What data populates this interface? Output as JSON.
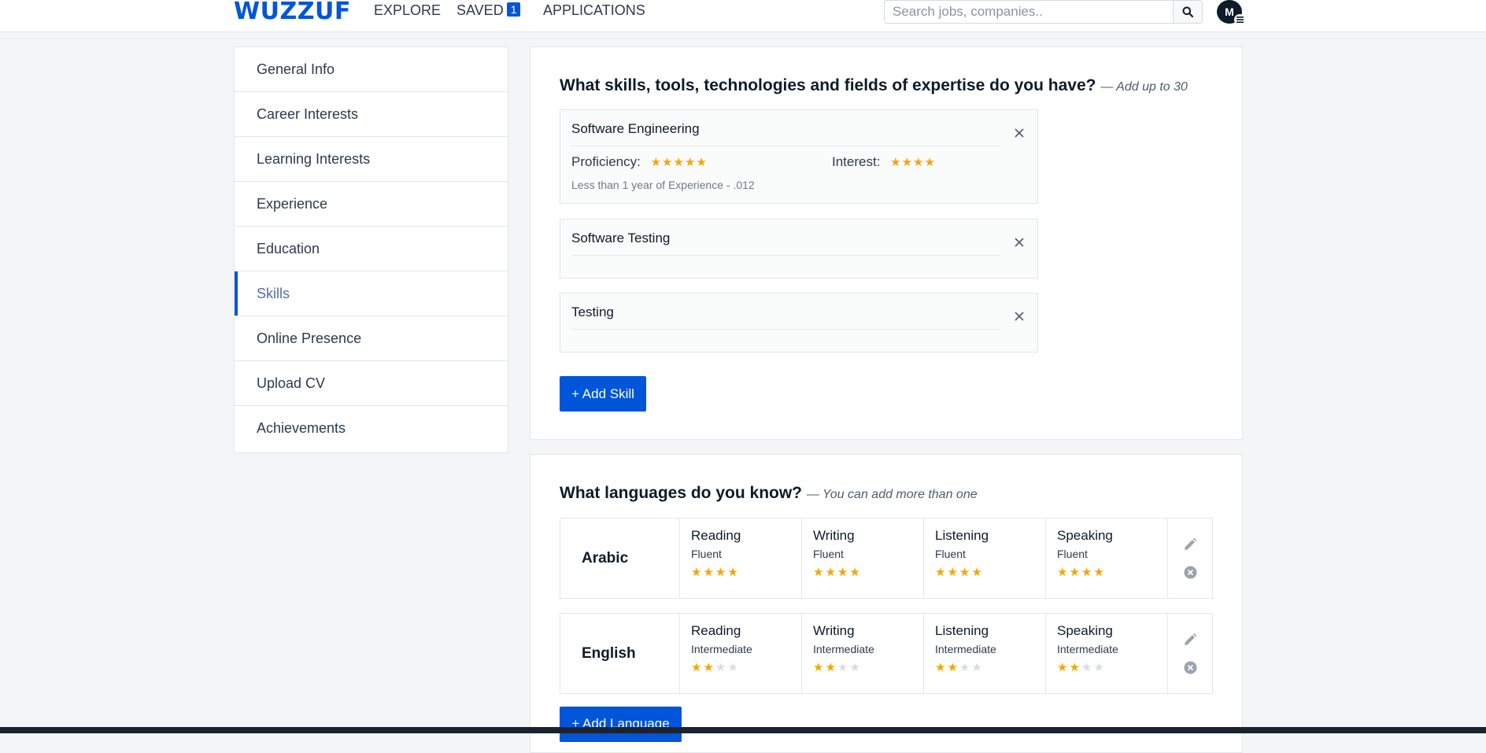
{
  "header": {
    "logo": "WUZZUF",
    "nav": {
      "explore": "EXPLORE",
      "saved": "SAVED",
      "saved_count": "1",
      "applications": "APPLICATIONS"
    },
    "search_placeholder": "Search jobs, companies..",
    "avatar_initial": "M"
  },
  "sidebar": {
    "items": [
      {
        "label": "General Info"
      },
      {
        "label": "Career Interests"
      },
      {
        "label": "Learning Interests"
      },
      {
        "label": "Experience"
      },
      {
        "label": "Education"
      },
      {
        "label": "Skills",
        "active": true
      },
      {
        "label": "Online Presence"
      },
      {
        "label": "Upload CV"
      },
      {
        "label": "Achievements"
      }
    ]
  },
  "skills_section": {
    "title": "What skills, tools, technologies and fields of expertise do you have?",
    "hint": "— Add up to 30",
    "proficiency_label": "Proficiency:",
    "interest_label": "Interest:",
    "skills": [
      {
        "name": "Software Engineering",
        "proficiency": 5,
        "interest": 4,
        "meta": "Less than 1 year of Experience - .012"
      },
      {
        "name": "Software Testing"
      },
      {
        "name": "Testing"
      }
    ],
    "add_button": "+ Add Skill"
  },
  "languages_section": {
    "title": "What languages do you know?",
    "hint": "— You can add more than one",
    "skill_labels": [
      "Reading",
      "Writing",
      "Listening",
      "Speaking"
    ],
    "languages": [
      {
        "name": "Arabic",
        "levels": [
          "Fluent",
          "Fluent",
          "Fluent",
          "Fluent"
        ],
        "stars": [
          4,
          4,
          4,
          4
        ],
        "max": 4
      },
      {
        "name": "English",
        "levels": [
          "Intermediate",
          "Intermediate",
          "Intermediate",
          "Intermediate"
        ],
        "stars": [
          2,
          2,
          2,
          2
        ],
        "max": 4
      }
    ],
    "add_button": "+ Add Language"
  },
  "colors": {
    "brand": "#0055d9",
    "star": "#f5a500",
    "star_empty": "#d9dde2"
  },
  "icons": {
    "search": "search-icon",
    "close": "close-icon",
    "edit": "pencil-icon",
    "delete": "remove-circle-icon",
    "menu": "menu-icon"
  }
}
